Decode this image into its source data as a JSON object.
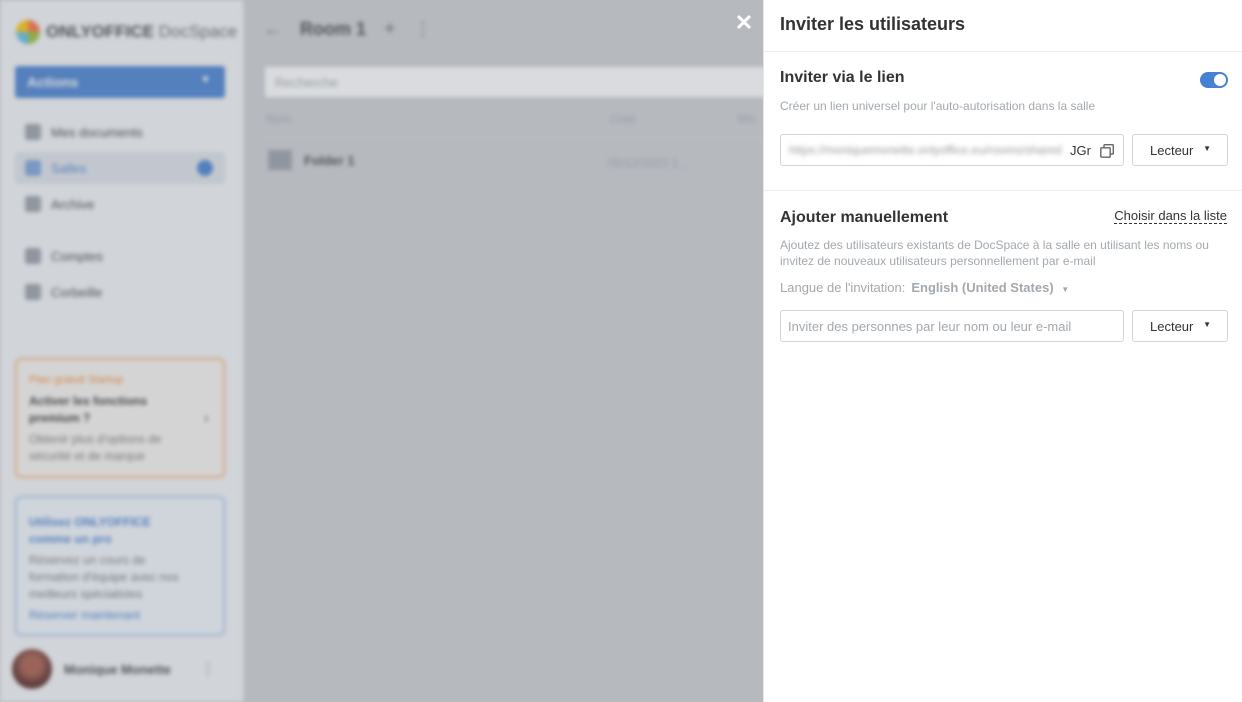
{
  "app": {
    "logo_brand": "ONLYOFFICE",
    "logo_product": " DocSpace",
    "actions_label": "Actions",
    "nav": [
      {
        "label": "Mes documents"
      },
      {
        "label": "Salles"
      },
      {
        "label": "Archive"
      },
      {
        "label": "Comptes"
      },
      {
        "label": "Corbeille"
      }
    ],
    "promo_orange": {
      "title": "Plan gratuit Startup",
      "heading": "Activer les fonctions premium ?",
      "text": "Obtenir plus d'options de sécurité et de marque"
    },
    "promo_blue": {
      "heading": "Utilisez ONLYOFFICE comme un pro",
      "text": "Réservez un cours de formation d'équipe avec nos meilleurs spécialistes",
      "link": "Réserver maintenant"
    },
    "user_name": "Monique Monette",
    "room_title": "Room 1",
    "search_placeholder": "Recherche",
    "columns": {
      "name": "Nom",
      "created": "Créé",
      "modified": "Mo"
    },
    "folder": {
      "name": "Folder 1",
      "date": "05/12/2023 1...",
      "date2": "05/1"
    }
  },
  "panel": {
    "title": "Inviter les utilisateurs",
    "link_section": {
      "title": "Inviter via le lien",
      "description": "Créer un lien universel pour l'auto-autorisation dans la salle",
      "toggle_on": true,
      "link_value": "https://moniquemonette.onlyoffice.eu/rooms/shared",
      "link_end": "JGr",
      "role": "Lecteur"
    },
    "manual_section": {
      "title": "Ajouter manuellement",
      "choose_from_list": "Choisir dans la liste",
      "description": "Ajoutez des utilisateurs existants de DocSpace à la salle en utilisant les noms ou invitez de nouveaux utilisateurs personnellement par e-mail",
      "language_label": "Langue de l'invitation:",
      "language_value": "English (United States)",
      "input_placeholder": "Inviter des personnes par leur nom ou leur e-mail",
      "role": "Lecteur"
    }
  },
  "colors": {
    "accent": "#4781d1",
    "muted_text": "#a3a9ae"
  }
}
